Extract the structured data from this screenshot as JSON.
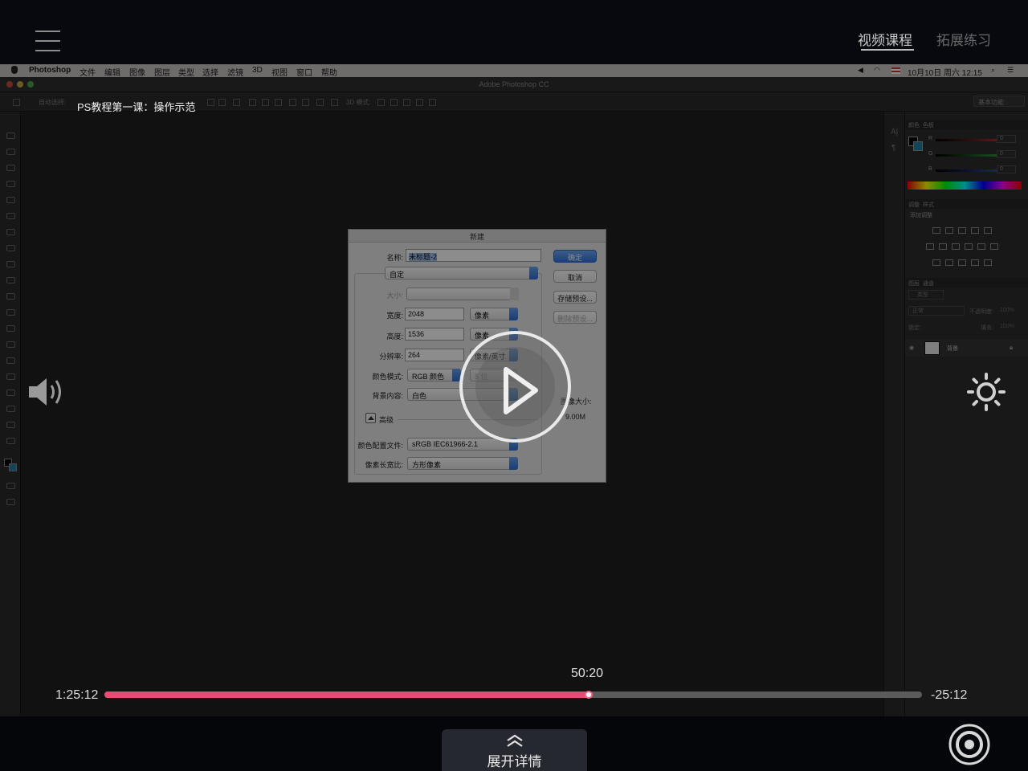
{
  "header": {
    "menu_icon": "hamburger-menu-icon",
    "tabs": [
      {
        "label": "视频课程",
        "active": true
      },
      {
        "label": "拓展练习",
        "active": false
      }
    ]
  },
  "mac_menubar": {
    "app_name": "Photoshop",
    "menus": [
      "文件",
      "编辑",
      "图像",
      "图层",
      "类型",
      "选择",
      "滤镜",
      "3D",
      "视图",
      "窗口",
      "帮助"
    ],
    "clock": "10月10日 周六 12:15"
  },
  "photoshop": {
    "window_title": "Adobe Photoshop CC",
    "options_bar": {
      "auto_select": "自动选择:",
      "mode_3d": "3D 模式:",
      "workspace": "基本功能"
    },
    "panels": {
      "color_tabs": [
        "颜色",
        "色板"
      ],
      "channels": [
        {
          "label": "R",
          "value": "0",
          "color": "#d93a3a"
        },
        {
          "label": "G",
          "value": "0",
          "color": "#3ab54a"
        },
        {
          "label": "B",
          "value": "0",
          "color": "#3a58d9"
        }
      ],
      "adjust_tabs": [
        "调整",
        "样式"
      ],
      "add_adjustment": "添加调整",
      "layers_tabs": [
        "图层",
        "通道"
      ],
      "layer_filter": "类型",
      "blend_mode": "正常",
      "opacity_label": "不透明度:",
      "opacity_value": "100%",
      "lock_label": "锁定:",
      "fill_label": "填充:",
      "fill_value": "100%",
      "layer_name": "背景"
    }
  },
  "video": {
    "title": "PS教程第一课：操作示范",
    "elapsed": "1:25:12",
    "remaining": "-25:12",
    "hover_time": "50:20",
    "progress": 0.592,
    "accent_color": "#e84b73"
  },
  "dialog": {
    "title": "新建",
    "name_label": "名称:",
    "name_value": "未标题-2",
    "preset_label": "预设:",
    "preset_value": "自定",
    "size_label": "大小:",
    "width_label": "宽度:",
    "width_value": "2048",
    "width_unit": "像素",
    "height_label": "高度:",
    "height_value": "1536",
    "height_unit": "像素",
    "resolution_label": "分辨率:",
    "resolution_value": "264",
    "resolution_unit": "像素/英寸",
    "color_mode_label": "颜色模式:",
    "color_mode_value": "RGB 颜色",
    "bit_depth": "8 位",
    "background_label": "背景内容:",
    "background_value": "白色",
    "advanced_label": "高级",
    "color_profile_label": "颜色配置文件:",
    "color_profile_value": "sRGB IEC61966-2.1",
    "pixel_aspect_label": "像素长宽比:",
    "pixel_aspect_value": "方形像素",
    "image_size_label": "图像大小:",
    "image_size_value": "9.00M",
    "buttons": {
      "ok": "确定",
      "cancel": "取消",
      "save_preset": "存储预设...",
      "delete_preset": "删除预设..."
    }
  },
  "controls": {
    "play_icon": "play-icon",
    "volume_icon": "volume-icon",
    "brightness_icon": "brightness-icon",
    "expand_label": "展开详情",
    "expand_icon": "double-chevron-up-icon",
    "record_icon": "record-icon"
  }
}
